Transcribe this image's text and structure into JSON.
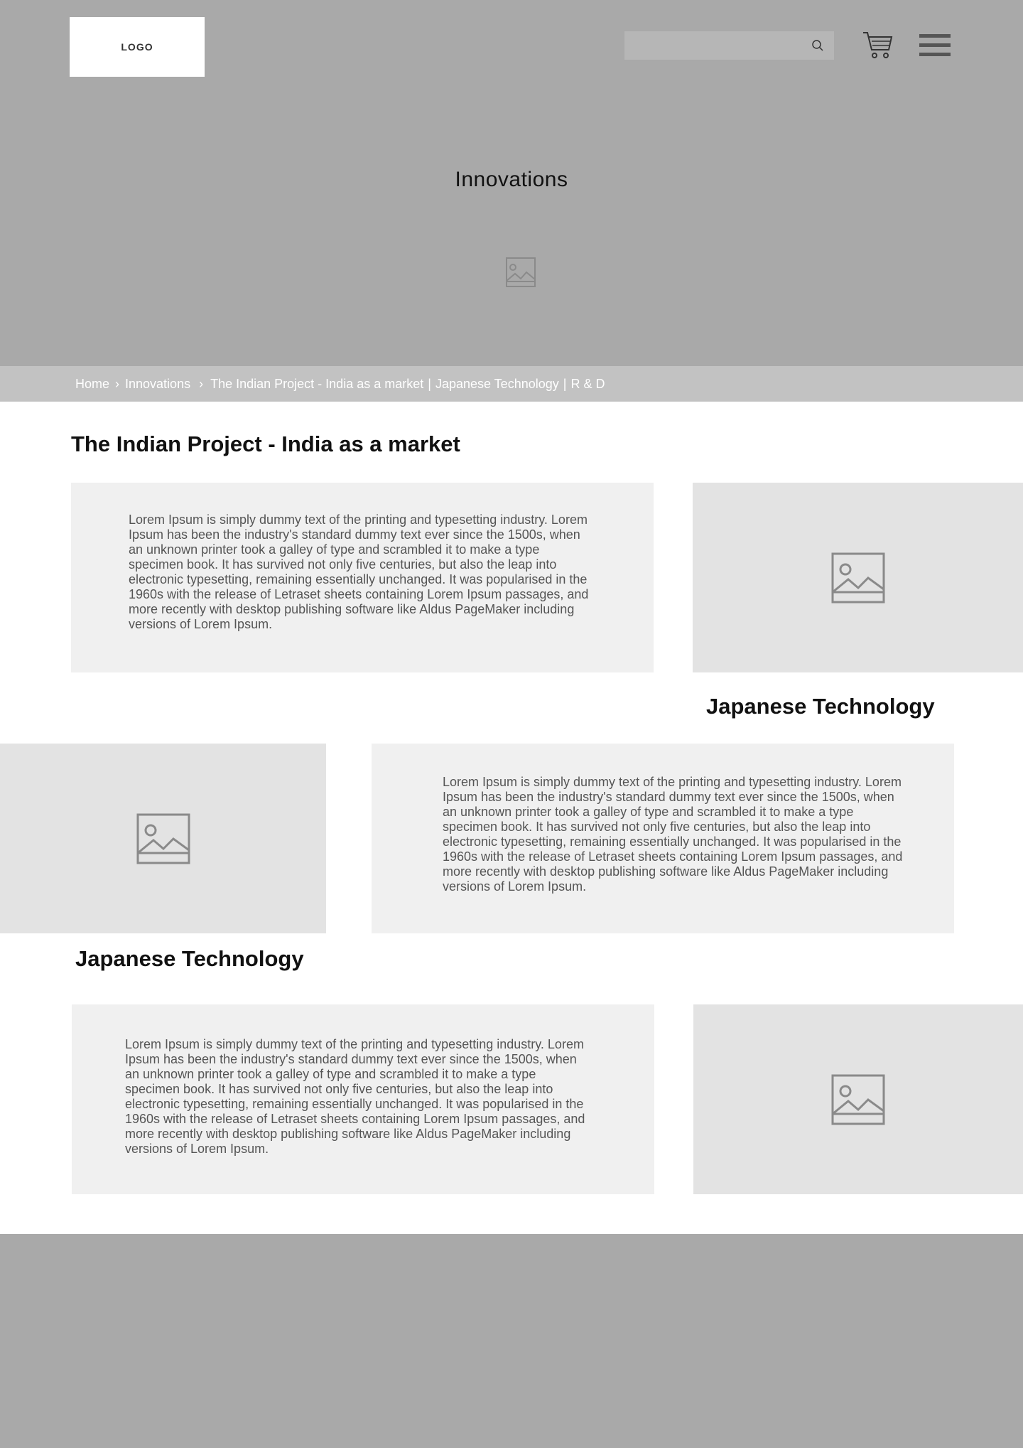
{
  "header": {
    "logo_text": "LOGO",
    "search_placeholder": "",
    "icons": [
      "search-icon",
      "cart-icon",
      "hamburger-menu-icon"
    ]
  },
  "hero": {
    "title": "Innovations",
    "image_icon": "image-placeholder-icon"
  },
  "breadcrumb": {
    "items": [
      "Home",
      "Innovations",
      "The Indian Project - India as a market",
      "Japanese Technology",
      "R & D"
    ]
  },
  "main": {
    "page_title": "The Indian Project - India as a market",
    "sections": [
      {
        "heading": "",
        "body": "Lorem Ipsum is simply dummy text of the printing and typesetting industry. Lorem Ipsum has been the industry's standard dummy text ever since the 1500s, when an unknown printer took a galley of type and scrambled it to make a type specimen book. It has survived not only five centuries, but also the leap into electronic typesetting, remaining essentially unchanged. It was popularised in the 1960s with the release of Letraset sheets containing Lorem Ipsum passages, and more recently with desktop publishing software like Aldus PageMaker including versions of Lorem Ipsum."
      },
      {
        "heading": "Japanese Technology",
        "body": "Lorem Ipsum is simply dummy text of the printing and typesetting industry. Lorem Ipsum has been the industry's standard dummy text ever since the 1500s, when an unknown printer took a galley of type and scrambled it to make a type specimen book. It has survived not only five centuries, but also the leap into electronic typesetting, remaining essentially unchanged. It was popularised in the 1960s with the release of Letraset sheets containing Lorem Ipsum passages, and more recently with desktop publishing software like Aldus PageMaker including versions of Lorem Ipsum."
      },
      {
        "heading": "Japanese Technology",
        "body": "Lorem Ipsum is simply dummy text of the printing and typesetting industry. Lorem Ipsum has been the industry's standard dummy text ever since the 1500s, when an unknown printer took a galley of type and scrambled it to make a type specimen book. It has survived not only five centuries, but also the leap into electronic typesetting, remaining essentially unchanged. It was popularised in the 1960s with the release of Letraset sheets containing Lorem Ipsum passages, and more recently with desktop publishing software like Aldus PageMaker including versions of Lorem Ipsum."
      }
    ]
  },
  "colors": {
    "header_bg": "#a9a9a9",
    "breadcrumb_bg": "#c2c2c2",
    "text_panel_bg": "#f0f0f0",
    "image_panel_bg": "#e3e3e3",
    "footer_bg": "#a9a9a9"
  }
}
